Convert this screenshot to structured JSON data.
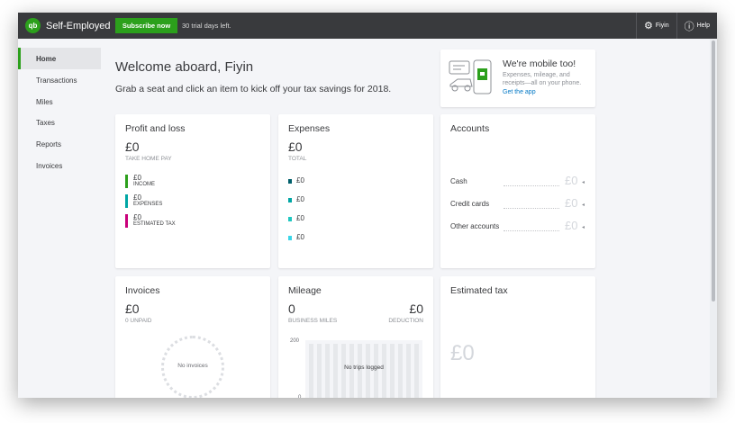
{
  "app": {
    "brand_name": "Self-Employed",
    "logo_text": "qb",
    "accent_color": "#2ca01c"
  },
  "topbar": {
    "subscribe_label": "Subscribe now",
    "trial_text": "30 trial days left.",
    "user_label": "Fiyin",
    "help_label": "Help",
    "user_icon": "gear-icon",
    "help_icon": "help-circle-icon"
  },
  "sidebar": {
    "items": [
      {
        "label": "Home",
        "active": true
      },
      {
        "label": "Transactions",
        "active": false
      },
      {
        "label": "Miles",
        "active": false
      },
      {
        "label": "Taxes",
        "active": false
      },
      {
        "label": "Reports",
        "active": false
      },
      {
        "label": "Invoices",
        "active": false
      }
    ]
  },
  "welcome": {
    "title": "Welcome aboard, Fiyin",
    "subtitle": "Grab a seat and click an item to kick off your tax savings for 2018."
  },
  "mobile": {
    "title": "We're mobile too!",
    "text": "Expenses, mileage, and receipts—all on your phone.",
    "link": "Get the app"
  },
  "profit_loss": {
    "title": "Profit and loss",
    "value": "£0",
    "caption": "TAKE HOME PAY",
    "rows": [
      {
        "value": "£0",
        "label": "INCOME",
        "color": "#2ca01c"
      },
      {
        "value": "£0",
        "label": "EXPENSES",
        "color": "#00a6a4"
      },
      {
        "value": "£0",
        "label": "ESTIMATED TAX",
        "color": "#c9007a"
      }
    ]
  },
  "expenses": {
    "title": "Expenses",
    "value": "£0",
    "caption": "TOTAL",
    "rows": [
      {
        "value": "£0",
        "color": "#005f6b"
      },
      {
        "value": "£0",
        "color": "#00a6a4"
      },
      {
        "value": "£0",
        "color": "#1fc7c0"
      },
      {
        "value": "£0",
        "color": "#3ad6e8"
      }
    ]
  },
  "accounts": {
    "title": "Accounts",
    "rows": [
      {
        "label": "Cash",
        "value": "£0"
      },
      {
        "label": "Credit cards",
        "value": "£0"
      },
      {
        "label": "Other accounts",
        "value": "£0"
      }
    ]
  },
  "invoices": {
    "title": "Invoices",
    "value": "£0",
    "caption": "0 UNPAID",
    "empty_text": "No invoices"
  },
  "mileage": {
    "title": "Mileage",
    "miles_value": "0",
    "miles_caption": "BUSINESS MILES",
    "deduction_value": "£0",
    "deduction_caption": "DEDUCTION",
    "axis_top": "200",
    "axis_bottom": "0",
    "empty_text": "No trips logged"
  },
  "estimated_tax": {
    "title": "Estimated tax",
    "value": "£0"
  }
}
